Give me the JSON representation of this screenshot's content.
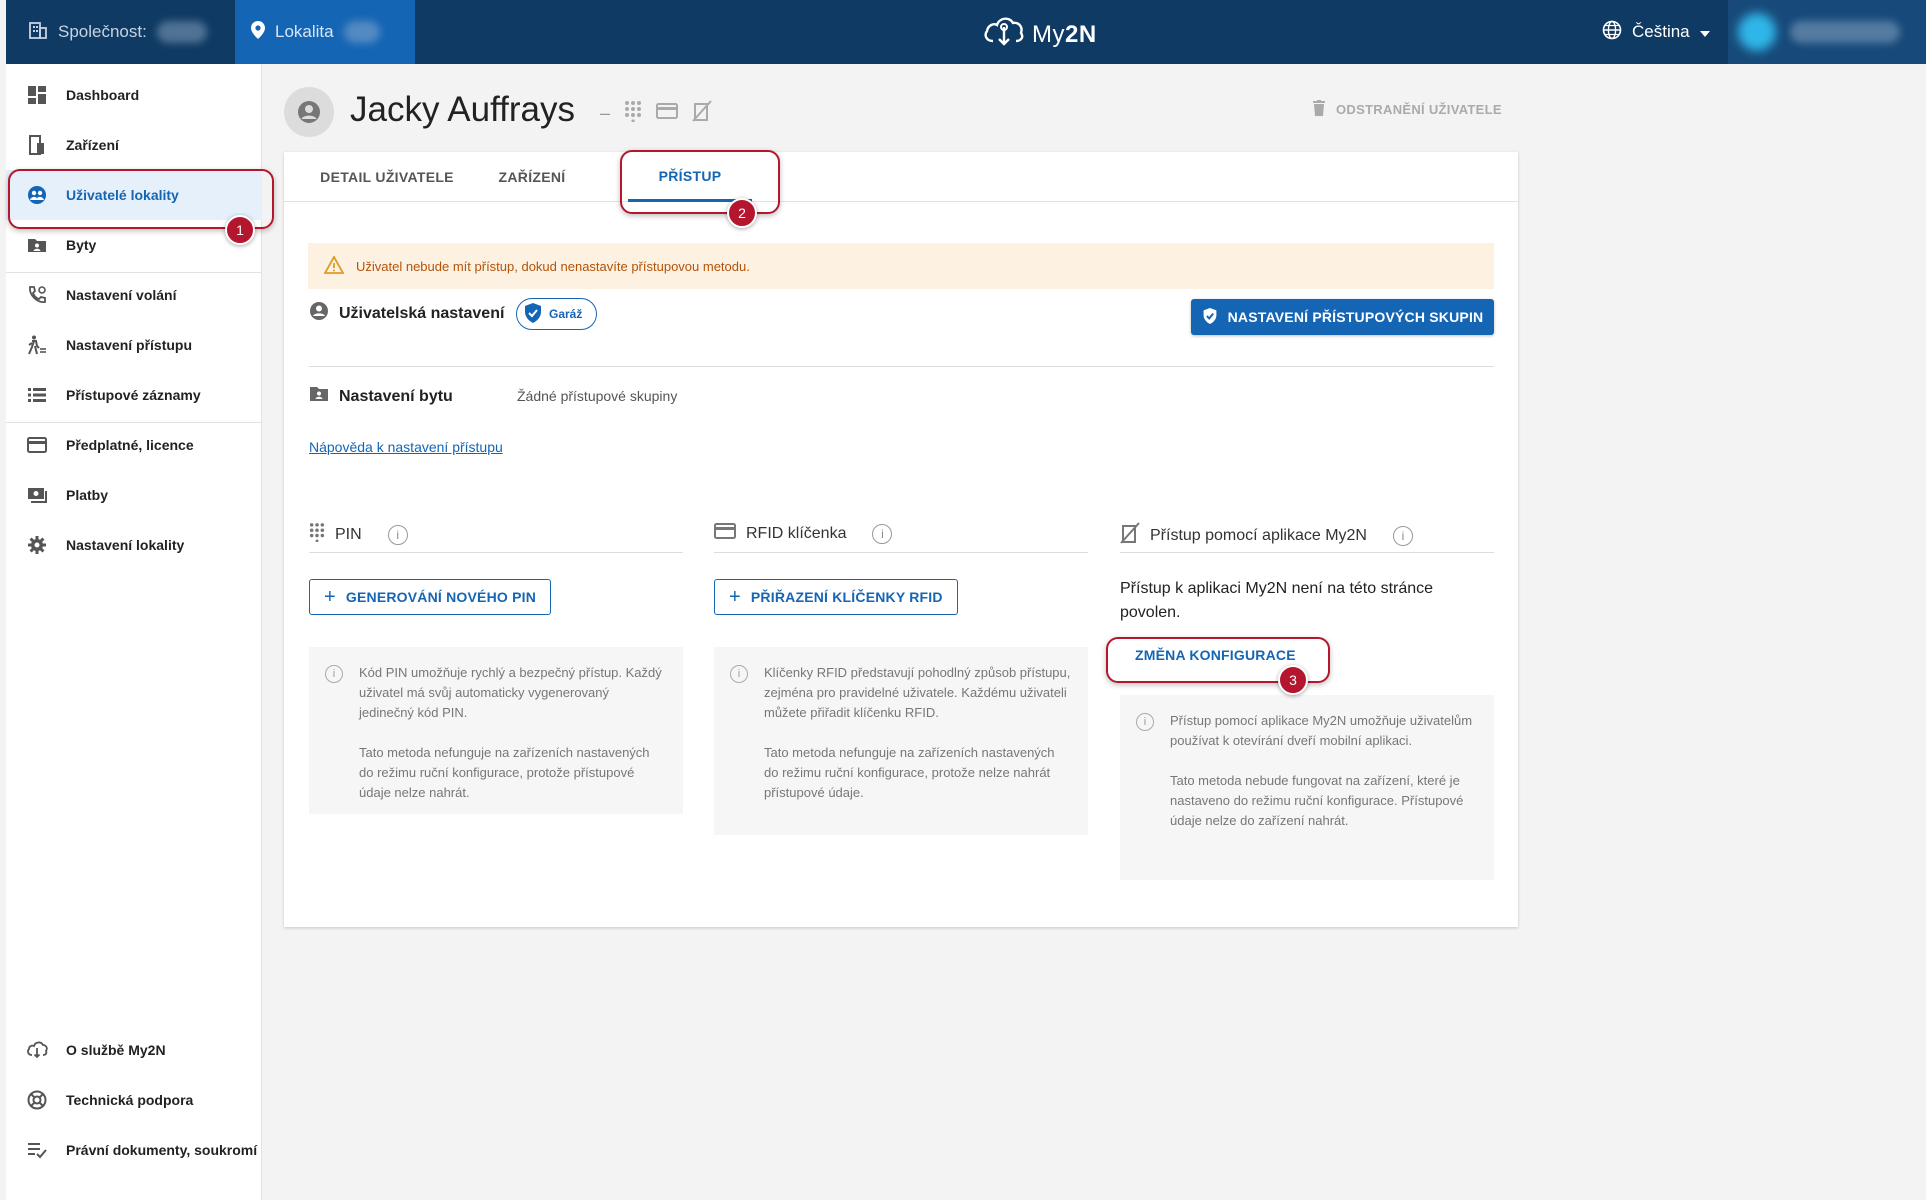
{
  "topbar": {
    "company_label": "Společnost:",
    "location_label": "Lokalita",
    "logo_text_light": "My",
    "logo_text_bold": "2N",
    "language": "Čeština"
  },
  "sidebar": {
    "items": [
      {
        "label": "Dashboard",
        "icon": "dashboard-icon"
      },
      {
        "label": "Zařízení",
        "icon": "device-icon"
      },
      {
        "label": "Uživatelé lokality",
        "icon": "users-icon",
        "active": true
      },
      {
        "label": "Byty",
        "icon": "apartment-icon"
      },
      {
        "label": "Nastavení volání",
        "icon": "phone-settings-icon"
      },
      {
        "label": "Nastavení přístupu",
        "icon": "access-icon"
      },
      {
        "label": "Přístupové záznamy",
        "icon": "list-icon"
      },
      {
        "label": "Předplatné, licence",
        "icon": "card-icon"
      },
      {
        "label": "Platby",
        "icon": "payment-icon"
      },
      {
        "label": "Nastavení lokality",
        "icon": "gear-icon"
      }
    ],
    "bottom_items": [
      {
        "label": "O službě My2N",
        "icon": "cloud-icon"
      },
      {
        "label": "Technická podpora",
        "icon": "support-icon"
      },
      {
        "label": "Právní dokumenty, soukromí",
        "icon": "legal-icon"
      }
    ]
  },
  "header": {
    "user_name": "Jacky Auffrays",
    "dash": "–",
    "delete_label": "ODSTRANĚNÍ UŽIVATELE"
  },
  "tabs": [
    "DETAIL UŽIVATELE",
    "ZAŘÍZENÍ",
    "PŘÍSTUP"
  ],
  "active_tab": "PŘÍSTUP",
  "annotations": [
    "1",
    "2",
    "3"
  ],
  "access": {
    "warning": "Uživatel nebude mít přístup, dokud nenastavíte přístupovou metodu.",
    "user_settings_label": "Uživatelská nastavení",
    "group_chip": "Garáž",
    "groups_button": "NASTAVENÍ PŘÍSTUPOVÝCH SKUPIN",
    "apartment_label": "Nastavení bytu",
    "apartment_value": "Žádné přístupové skupiny",
    "help_link": "Nápověda k nastavení přístupu"
  },
  "methods": {
    "pin": {
      "title": "PIN",
      "button": "GENEROVÁNÍ NOVÉHO PIN",
      "info_p1": "Kód PIN umožňuje rychlý a bezpečný přístup. Každý uživatel má svůj automaticky vygenerovaný jedinečný kód PIN.",
      "info_p2": "Tato metoda nefunguje na zařízeních nastavených do režimu ruční konfigurace, protože přístupové údaje nelze nahrát."
    },
    "rfid": {
      "title": "RFID klíčenka",
      "button": "PŘIŘAZENÍ KLÍČENKY RFID",
      "info_p1": "Klíčenky RFID představují pohodlný způsob přístupu, zejména pro pravidelné uživatele. Každému uživateli můžete přiřadit klíčenku RFID.",
      "info_p2": "Tato metoda nefunguje na zařízeních nastavených do režimu ruční konfigurace, protože nelze nahrát přístupové údaje."
    },
    "app": {
      "title": "Přístup pomocí aplikace My2N",
      "text": "Přístup k aplikaci My2N není na této stránce povolen.",
      "button": "ZMĚNA KONFIGURACE",
      "info_p1": "Přístup pomocí aplikace My2N umožňuje uživatelům používat k otevírání dveří mobilní aplikaci.",
      "info_p2": "Tato metoda nebude fungovat na zařízení, které je nastaveno do režimu ruční konfigurace. Přístupové údaje nelze do zařízení nahrát."
    }
  }
}
